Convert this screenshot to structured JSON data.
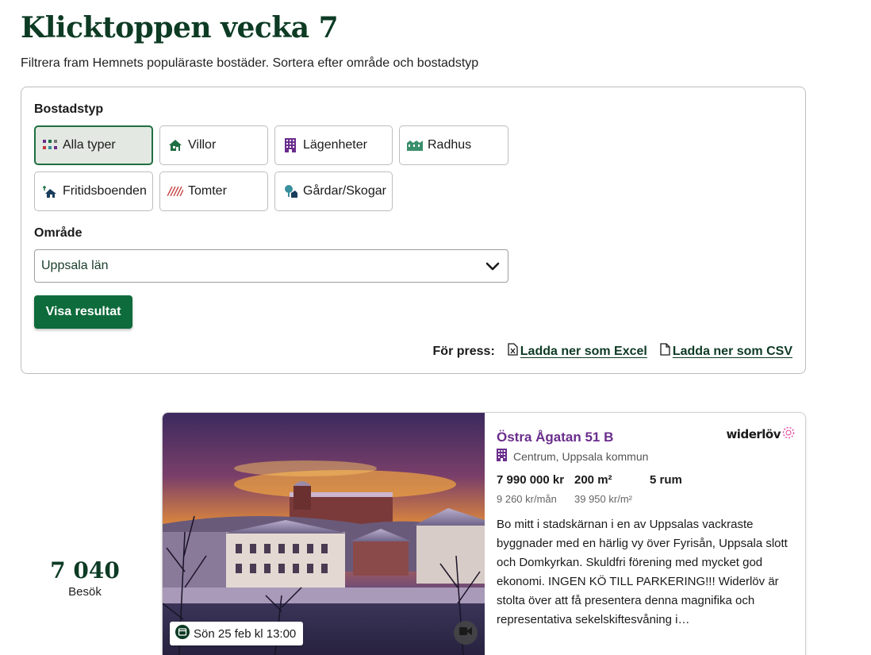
{
  "page": {
    "title": "Klicktoppen vecka 7",
    "subtitle": "Filtrera fram Hemnets populäraste bostäder. Sortera efter område och bostadstyp"
  },
  "filters": {
    "type_label": "Bostadstyp",
    "types": [
      {
        "label": "Alla typer",
        "icon": "grid-icon",
        "selected": true
      },
      {
        "label": "Villor",
        "icon": "house-icon",
        "selected": false
      },
      {
        "label": "Lägenheter",
        "icon": "apartment-building-icon",
        "selected": false
      },
      {
        "label": "Radhus",
        "icon": "townhouse-icon",
        "selected": false
      },
      {
        "label": "Fritidsboenden",
        "icon": "cabin-icon",
        "selected": false
      },
      {
        "label": "Tomter",
        "icon": "plot-icon",
        "selected": false
      },
      {
        "label": "Gårdar/Skogar",
        "icon": "farm-tree-icon",
        "selected": false
      }
    ],
    "area_label": "Område",
    "area_value": "Uppsala län",
    "submit_label": "Visa resultat",
    "press_label": "För press:",
    "excel_link": "Ladda ner som Excel",
    "csv_link": "Ladda ner som CSV"
  },
  "listing": {
    "visits": "7 040",
    "visits_label": "Besök",
    "viewing": "Sön 25 feb kl 13:00",
    "address": "Östra Ågatan 51 B",
    "broker": "widerlöv",
    "location": "Centrum, Uppsala kommun",
    "price": "7 990 000 kr",
    "size": "200 m²",
    "rooms": "5 rum",
    "fee": "9 260 kr/mån",
    "price_per_sqm": "39 950 kr/m²",
    "description": "Bo mitt i stadskärnan i en av Uppsalas vackraste byggnader med en härlig vy över Fyrisån, Uppsala slott och Domkyrkan. Skuldfri förening med mycket god ekonomi.   INGEN KÖ TILL PARKERING!!! Widerlöv är stolta över att få presentera denna magnifika och representativa sekelskiftesvåning i…"
  },
  "colors": {
    "brand_green": "#0e6b3b",
    "heading_green": "#0d3b24",
    "address_purple": "#6a2d8c",
    "broker_pink": "#e0409a"
  }
}
